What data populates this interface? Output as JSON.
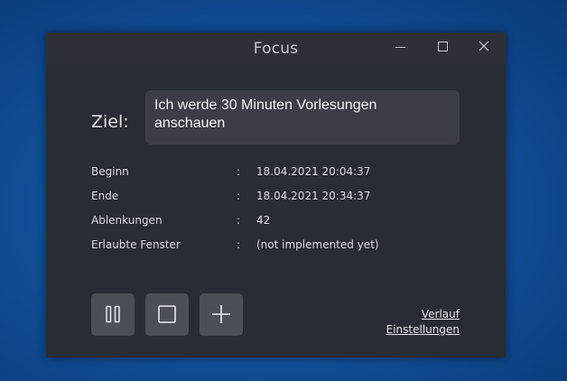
{
  "window": {
    "title": "Focus",
    "controls": {
      "minimize_icon": "minimize-icon",
      "maximize_icon": "maximize-icon",
      "close_icon": "close-icon"
    }
  },
  "goal": {
    "label": "Ziel:",
    "text": "Ich werde 30 Minuten Vorlesungen anschauen"
  },
  "info": [
    {
      "label": "Beginn",
      "sep": ":",
      "value": "18.04.2021 20:04:37"
    },
    {
      "label": "Ende",
      "sep": ":",
      "value": "18.04.2021 20:34:37"
    },
    {
      "label": "Ablenkungen",
      "sep": ":",
      "value": "42"
    },
    {
      "label": "Erlaubte Fenster",
      "sep": ":",
      "value": "(not implemented yet)"
    }
  ],
  "controls": {
    "pause_icon": "pause-icon",
    "stop_icon": "stop-icon",
    "add_icon": "plus-icon"
  },
  "links": {
    "history": "Verlauf",
    "settings": "Einstellungen"
  },
  "colors": {
    "desktop": "#12509a",
    "window_bg": "#282c34",
    "titlebar_bg": "#2d3137",
    "goal_box_bg": "#3b3f45",
    "button_bg": "#4b5056"
  }
}
